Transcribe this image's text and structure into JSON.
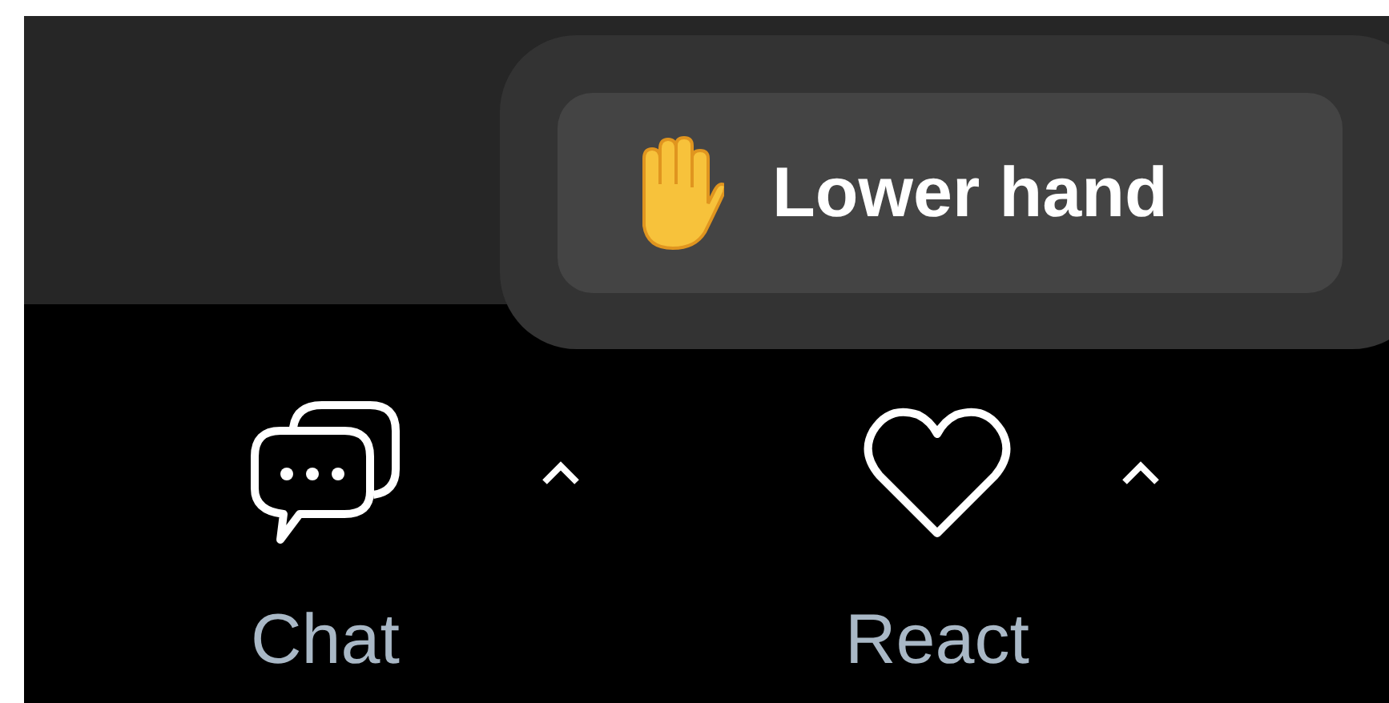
{
  "popup": {
    "button": {
      "label": "Lower hand"
    }
  },
  "toolbar": {
    "items": [
      {
        "kind": "chat",
        "label": "Chat"
      },
      {
        "kind": "react",
        "label": "React"
      }
    ]
  }
}
